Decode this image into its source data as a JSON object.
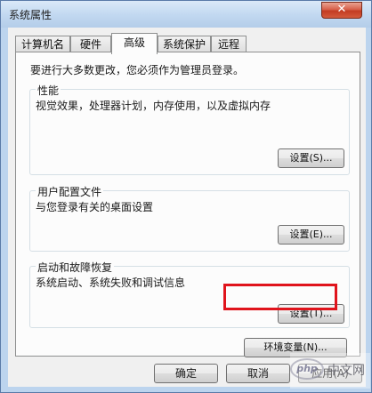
{
  "window": {
    "title": "系统属性",
    "close_glyph": "✕"
  },
  "tabs": [
    {
      "label": "计算机名",
      "active": false
    },
    {
      "label": "硬件",
      "active": false
    },
    {
      "label": "高级",
      "active": true
    },
    {
      "label": "系统保护",
      "active": false
    },
    {
      "label": "远程",
      "active": false
    }
  ],
  "advanced": {
    "intro": "要进行大多数更改，您必须作为管理员登录。",
    "performance": {
      "title": "性能",
      "description": "视觉效果，处理器计划，内存使用，以及虚拟内存",
      "button": "设置(S)..."
    },
    "user_profiles": {
      "title": "用户配置文件",
      "description": "与您登录有关的桌面设置",
      "button": "设置(E)..."
    },
    "startup_recovery": {
      "title": "启动和故障恢复",
      "description": "系统启动、系统失败和调试信息",
      "button": "设置(T)..."
    },
    "env_button": "环境变量(N)..."
  },
  "footer": {
    "ok": "确定",
    "cancel": "取消",
    "apply": "应用(A)"
  },
  "watermark": {
    "logo": "php",
    "text": "中文网"
  },
  "colors": {
    "highlight": "#e0141c",
    "close_button": "#c33c22"
  }
}
